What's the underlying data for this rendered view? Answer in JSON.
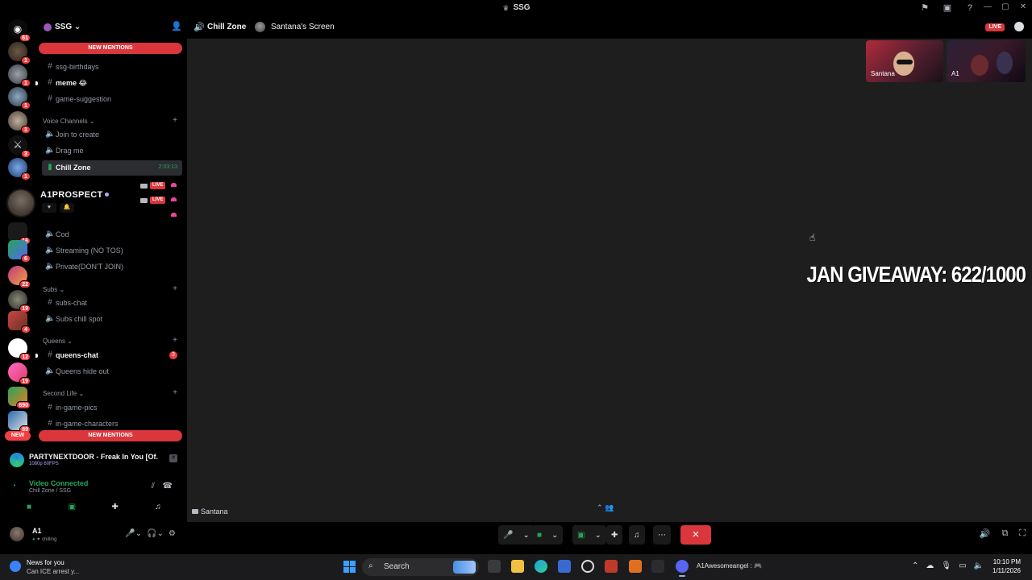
{
  "window": {
    "title": "SSG",
    "title_icon": "trophy-icon"
  },
  "server": {
    "name": "SSG",
    "new_mentions_label": "NEW MENTIONS"
  },
  "rail": {
    "top_badge": "61",
    "new_label": "NEW",
    "server_badges": [
      "1",
      "1",
      "1",
      "1",
      "3",
      "1",
      "16",
      "6",
      "22",
      "19",
      "4",
      "12",
      "19",
      "690",
      "89"
    ]
  },
  "channels": {
    "text_top": [
      {
        "label": "ssg-birthdays",
        "bold": false
      },
      {
        "label": "meme 😂",
        "bold": true
      },
      {
        "label": "game-suggestion",
        "bold": false
      }
    ],
    "voice_category": "Voice Channels ⌄",
    "voice": [
      {
        "label": "Join to create"
      },
      {
        "label": "Drag me"
      },
      {
        "label": "Chill Zone",
        "timer": "2:03:13"
      }
    ],
    "voice_lower": [
      {
        "label": "Cod"
      },
      {
        "label": "Streaming (NO TOS)"
      },
      {
        "label": "Private(DON'T JOIN)"
      }
    ],
    "subs_category": "Subs ⌄",
    "subs": [
      {
        "label": "subs-chat"
      },
      {
        "label": "Subs chill spot"
      }
    ],
    "queens_category": "Queens ⌄",
    "queens": [
      {
        "label": "queens-chat",
        "count": "3"
      },
      {
        "label": "Queens hide out"
      }
    ],
    "secondlife_category": "Second Life ⌄",
    "secondlife": [
      {
        "label": "in-game-pics"
      },
      {
        "label": "in-game-characters"
      }
    ],
    "live_label": "LIVE"
  },
  "profile_popup": {
    "name": "A1PROSPECT"
  },
  "now_playing": {
    "title": "PARTYNEXTDOOR - Freak In You [Of...",
    "sub": "1080p 60FPS"
  },
  "voice_panel": {
    "status": "Video Connected",
    "location": "Chill Zone / SSG"
  },
  "user": {
    "name": "A1",
    "status": "chilling"
  },
  "stage": {
    "channel": "Chill Zone",
    "screen_label": "Santana's Screen",
    "live_label": "LIVE",
    "giveaway": "JAN GIVEAWAY: 622/1000",
    "footer_name": "Santana",
    "tiles": [
      {
        "name": "Santana"
      },
      {
        "name": "A1"
      }
    ]
  },
  "taskbar": {
    "news_title": "News for you",
    "news_headline": "Can ICE arrest y...",
    "search_placeholder": "Search",
    "active_tab": "A1Awesomeangel : 🎮",
    "time": "10:10 PM",
    "date": "1/11/2026"
  },
  "colors": {
    "accent_red": "#da373c",
    "voice_green": "#23a55a",
    "stage_bg": "#1e1e1f"
  }
}
